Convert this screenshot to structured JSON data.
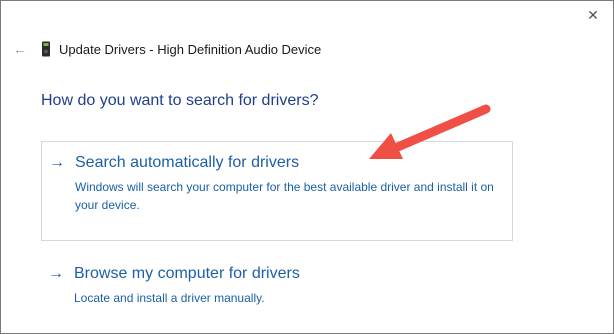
{
  "window": {
    "title": "Update Drivers - High Definition Audio Device",
    "close_glyph": "✕",
    "back_glyph": "←"
  },
  "main": {
    "heading": "How do you want to search for drivers?",
    "options": [
      {
        "arrow": "→",
        "title": "Search automatically for drivers",
        "description": "Windows will search your computer for the best available driver and install it on your device."
      },
      {
        "arrow": "→",
        "title": "Browse my computer for drivers",
        "description": "Locate and install a driver manually."
      }
    ]
  },
  "colors": {
    "accent_link": "#1c5fa8",
    "heading": "#1f3e8c",
    "annotation_arrow": "#ef4f45"
  },
  "icons": {
    "back": "back-arrow-icon",
    "device": "audio-device-icon",
    "close": "close-icon",
    "option_arrow": "right-arrow-icon",
    "annotation": "annotation-arrow-icon"
  }
}
